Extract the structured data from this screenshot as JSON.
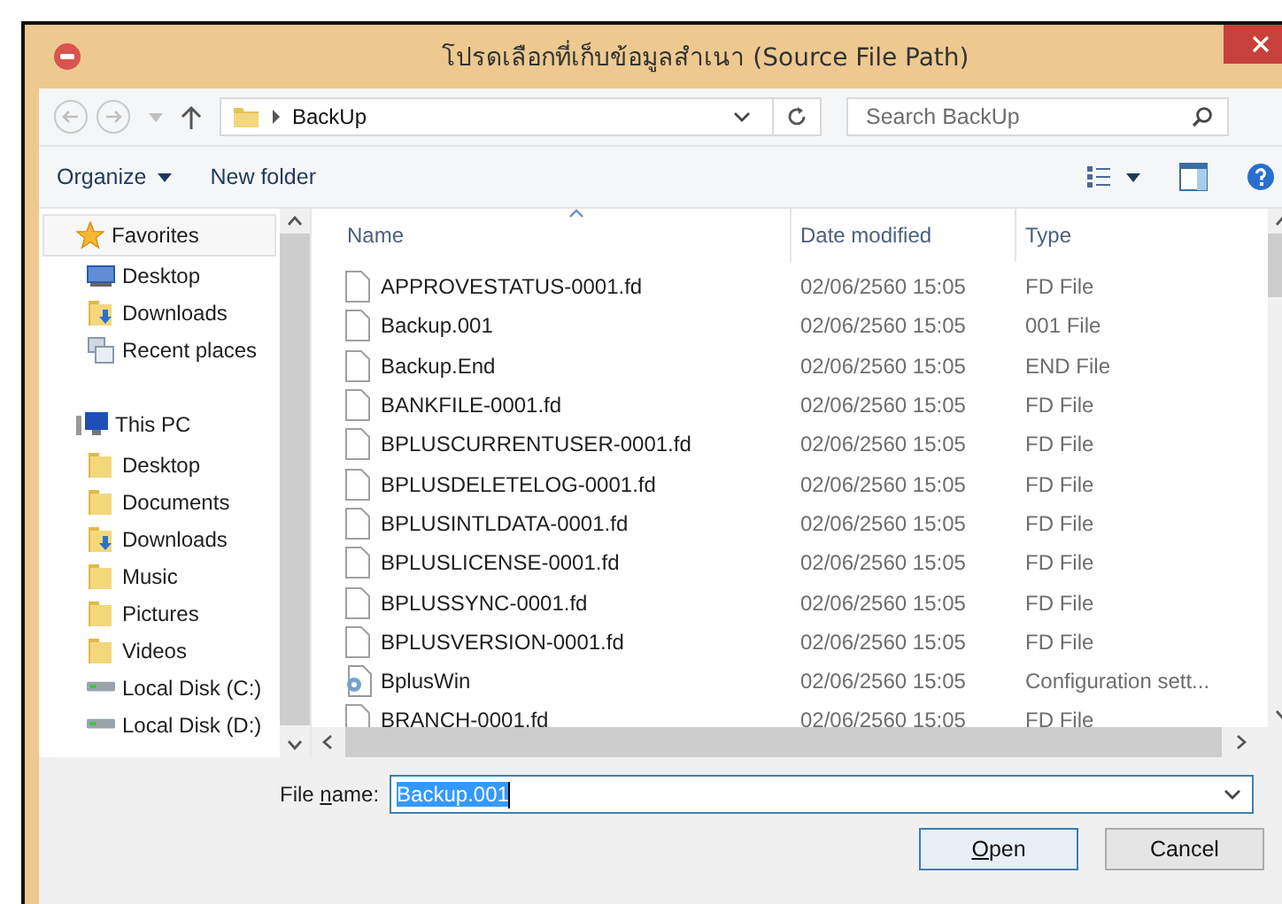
{
  "window": {
    "title": "โปรดเลือกที่เก็บข้อมูลสำเนา (Source File Path)"
  },
  "address_bar": {
    "path": "BackUp"
  },
  "search": {
    "placeholder": "Search BackUp"
  },
  "toolbar": {
    "organize": "Organize",
    "new_folder": "New folder"
  },
  "sidebar": {
    "groups": [
      {
        "label": "Favorites",
        "kind": "star",
        "selected": true,
        "children": [
          {
            "label": "Desktop",
            "kind": "desktop"
          },
          {
            "label": "Downloads",
            "kind": "download"
          },
          {
            "label": "Recent places",
            "kind": "recent"
          }
        ]
      },
      {
        "label": "This PC",
        "kind": "pc",
        "selected": false,
        "children": [
          {
            "label": "Desktop",
            "kind": "folder"
          },
          {
            "label": "Documents",
            "kind": "folder"
          },
          {
            "label": "Downloads",
            "kind": "download"
          },
          {
            "label": "Music",
            "kind": "folder"
          },
          {
            "label": "Pictures",
            "kind": "folder"
          },
          {
            "label": "Videos",
            "kind": "folder"
          },
          {
            "label": "Local Disk (C:)",
            "kind": "drive"
          },
          {
            "label": "Local Disk (D:)",
            "kind": "drive"
          }
        ]
      }
    ]
  },
  "table": {
    "columns": [
      "Name",
      "Date modified",
      "Type"
    ],
    "rows": [
      {
        "name": "APPROVESTATUS-0001.fd",
        "date": "02/06/2560 15:05",
        "type": "FD File",
        "kind": "file"
      },
      {
        "name": "Backup.001",
        "date": "02/06/2560 15:05",
        "type": "001 File",
        "kind": "file"
      },
      {
        "name": "Backup.End",
        "date": "02/06/2560 15:05",
        "type": "END File",
        "kind": "file"
      },
      {
        "name": "BANKFILE-0001.fd",
        "date": "02/06/2560 15:05",
        "type": "FD File",
        "kind": "file"
      },
      {
        "name": "BPLUSCURRENTUSER-0001.fd",
        "date": "02/06/2560 15:05",
        "type": "FD File",
        "kind": "file"
      },
      {
        "name": "BPLUSDELETELOG-0001.fd",
        "date": "02/06/2560 15:05",
        "type": "FD File",
        "kind": "file"
      },
      {
        "name": "BPLUSINTLDATA-0001.fd",
        "date": "02/06/2560 15:05",
        "type": "FD File",
        "kind": "file"
      },
      {
        "name": "BPLUSLICENSE-0001.fd",
        "date": "02/06/2560 15:05",
        "type": "FD File",
        "kind": "file"
      },
      {
        "name": "BPLUSSYNC-0001.fd",
        "date": "02/06/2560 15:05",
        "type": "FD File",
        "kind": "file"
      },
      {
        "name": "BPLUSVERSION-0001.fd",
        "date": "02/06/2560 15:05",
        "type": "FD File",
        "kind": "file"
      },
      {
        "name": "BplusWin",
        "date": "02/06/2560 15:05",
        "type": "Configuration sett...",
        "kind": "config"
      },
      {
        "name": "BRANCH-0001.fd",
        "date": "02/06/2560 15:05",
        "type": "FD File",
        "kind": "file"
      }
    ]
  },
  "file_name": {
    "label_before": "File ",
    "mnemonic": "n",
    "label_after": "ame:",
    "value": "Backup.001"
  },
  "buttons": [
    {
      "mnemonic": "O",
      "label_after": "pen",
      "default": true
    },
    {
      "label_before": "Cancel",
      "default": false
    }
  ]
}
